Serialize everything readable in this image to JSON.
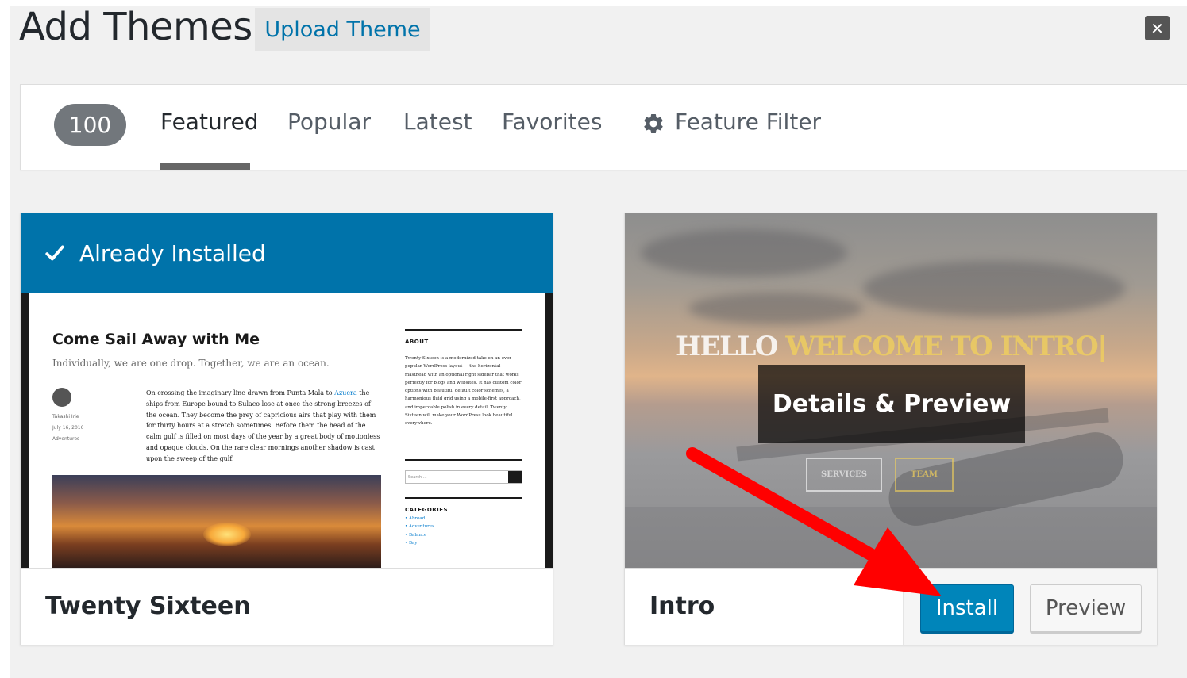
{
  "header": {
    "title": "Add Themes",
    "upload_label": "Upload Theme",
    "close_glyph": "✕"
  },
  "filter_bar": {
    "count": "100",
    "tabs": [
      {
        "label": "Featured",
        "active": true
      },
      {
        "label": "Popular",
        "active": false
      },
      {
        "label": "Latest",
        "active": false
      },
      {
        "label": "Favorites",
        "active": false
      }
    ],
    "feature_filter_label": "Feature Filter",
    "feature_filter_icon": "gear-icon"
  },
  "themes": [
    {
      "name": "Twenty Sixteen",
      "status": "Already Installed",
      "status_icon": "checkmark-icon",
      "screenshot": {
        "site_title": "Come Sail Away with Me",
        "tagline": "Individually, we are one drop. Together, we are an ocean.",
        "author": "Takashi Irie",
        "date": "July 16, 2016",
        "category": "Adventures",
        "body_before_link": "On crossing the imaginary line drawn from Punta Mala to ",
        "body_link": "Azuera",
        "body_after_link": " the ships from Europe bound to Sulaco lose at once the strong breezes of the ocean. They become the prey of capricious airs that play with them for thirty hours at a stretch sometimes. Before them the head of the calm gulf is filled on most days of the year by a great body of motionless and opaque clouds. On the rare clear mornings another shadow is cast upon the sweep of the gulf.",
        "about_heading": "ABOUT",
        "about_text": "Twenty Sixteen is a modernized take on an ever-popular WordPress layout — the horizontal masthead with an optional right sidebar that works perfectly for blogs and websites. It has custom color options with beautiful default color schemes, a harmonious fluid grid using a mobile-first approach, and impeccable polish in every detail. Twenty Sixteen will make your WordPress look beautiful everywhere.",
        "search_placeholder": "Search ...",
        "categories_heading": "CATEGORIES",
        "categories": [
          "Abroad",
          "Adventures",
          "Balance",
          "Bay"
        ]
      }
    },
    {
      "name": "Intro",
      "screenshot": {
        "hero_word1": "HELLO",
        "hero_word2": "WELCOME TO INTRO|",
        "button1": "SERVICES",
        "button2": "TEAM"
      },
      "details_label": "Details & Preview",
      "install_label": "Install",
      "preview_label": "Preview"
    }
  ],
  "colors": {
    "accent_blue": "#0073aa",
    "install_blue": "#0085ba",
    "arrow_red": "#ff0000",
    "badge_gray": "#72777c"
  }
}
